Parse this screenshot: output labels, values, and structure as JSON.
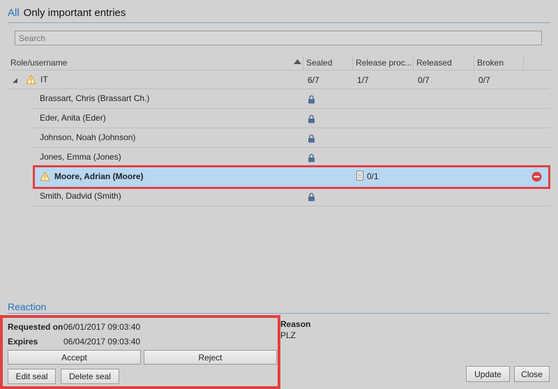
{
  "filter": {
    "all_label": "All",
    "important_label": "Only important entries"
  },
  "search": {
    "placeholder": "Search"
  },
  "columns": [
    "Role/username",
    "Sealed",
    "Release proc...",
    "Released",
    "Broken"
  ],
  "group": {
    "name": "IT",
    "sealed": "6/7",
    "release_proc": "1/7",
    "released": "0/7",
    "broken": "0/7"
  },
  "rows": [
    {
      "name": "Brassart, Chris (Brassart Ch.)"
    },
    {
      "name": "Eder, Anita (Eder)"
    },
    {
      "name": "Johnson, Noah (Johnson)"
    },
    {
      "name": "Jones, Emma (Jones)"
    },
    {
      "name": "Moore, Adrian (Moore)",
      "release_proc": "0/1"
    },
    {
      "name": "Smith, Dadvid (Smith)"
    }
  ],
  "reaction": {
    "title": "Reaction",
    "requested_label": "Requested on",
    "requested_value": "06/01/2017 09:03:40",
    "expires_label": "Expires",
    "expires_value": "06/04/2017 09:03:40",
    "reason_label": "Reason",
    "reason_value": "PLZ",
    "accept": "Accept",
    "reject": "Reject",
    "edit_seal": "Edit seal",
    "delete_seal": "Delete seal"
  },
  "footer": {
    "update": "Update",
    "close": "Close"
  },
  "colors": {
    "accent": "#1e73be",
    "highlight": "#e2403f",
    "selected_row": "#b8d7f0"
  },
  "icons": {
    "warning": "warning-icon",
    "lock": "lock-icon",
    "remove": "remove-icon",
    "sort": "sort-ascending-icon",
    "expander": "collapse-triangle-icon",
    "document": "document-icon"
  }
}
